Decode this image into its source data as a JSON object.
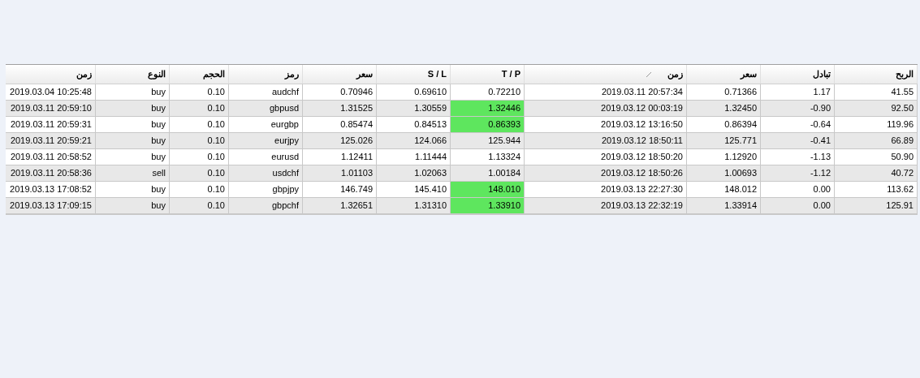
{
  "table": {
    "columns": [
      {
        "label": "زمن",
        "sorted": false
      },
      {
        "label": "النوع",
        "sorted": false
      },
      {
        "label": "الحجم",
        "sorted": false
      },
      {
        "label": "رمز",
        "sorted": false
      },
      {
        "label": "سعر",
        "sorted": false
      },
      {
        "label": "S / L",
        "sorted": false
      },
      {
        "label": "T / P",
        "sorted": false
      },
      {
        "label": "زمن",
        "sorted": true
      },
      {
        "label": "سعر",
        "sorted": false
      },
      {
        "label": "تبادل",
        "sorted": false
      },
      {
        "label": "الربح",
        "sorted": false
      }
    ],
    "rows": [
      {
        "cells": [
          "2019.03.04 10:25:48",
          "buy",
          "0.10",
          "audchf",
          "0.70946",
          "0.69610",
          "0.72210",
          "2019.03.11 20:57:34",
          "0.71366",
          "1.17",
          "41.55"
        ],
        "tp_hit": false
      },
      {
        "cells": [
          "2019.03.11 20:59:10",
          "buy",
          "0.10",
          "gbpusd",
          "1.31525",
          "1.30559",
          "1.32446",
          "2019.03.12 00:03:19",
          "1.32450",
          "-0.90",
          "92.50"
        ],
        "tp_hit": true
      },
      {
        "cells": [
          "2019.03.11 20:59:31",
          "buy",
          "0.10",
          "eurgbp",
          "0.85474",
          "0.84513",
          "0.86393",
          "2019.03.12 13:16:50",
          "0.86394",
          "-0.64",
          "119.96"
        ],
        "tp_hit": true
      },
      {
        "cells": [
          "2019.03.11 20:59:21",
          "buy",
          "0.10",
          "eurjpy",
          "125.026",
          "124.066",
          "125.944",
          "2019.03.12 18:50:11",
          "125.771",
          "-0.41",
          "66.89"
        ],
        "tp_hit": false
      },
      {
        "cells": [
          "2019.03.11 20:58:52",
          "buy",
          "0.10",
          "eurusd",
          "1.12411",
          "1.11444",
          "1.13324",
          "2019.03.12 18:50:20",
          "1.12920",
          "-1.13",
          "50.90"
        ],
        "tp_hit": false
      },
      {
        "cells": [
          "2019.03.11 20:58:36",
          "sell",
          "0.10",
          "usdchf",
          "1.01103",
          "1.02063",
          "1.00184",
          "2019.03.12 18:50:26",
          "1.00693",
          "-1.12",
          "40.72"
        ],
        "tp_hit": false
      },
      {
        "cells": [
          "2019.03.13 17:08:52",
          "buy",
          "0.10",
          "gbpjpy",
          "146.749",
          "145.410",
          "148.010",
          "2019.03.13 22:27:30",
          "148.012",
          "0.00",
          "113.62"
        ],
        "tp_hit": true
      },
      {
        "cells": [
          "2019.03.13 17:09:15",
          "buy",
          "0.10",
          "gbpchf",
          "1.32651",
          "1.31310",
          "1.33910",
          "2019.03.13 22:32:19",
          "1.33914",
          "0.00",
          "125.91"
        ],
        "tp_hit": true
      }
    ]
  }
}
